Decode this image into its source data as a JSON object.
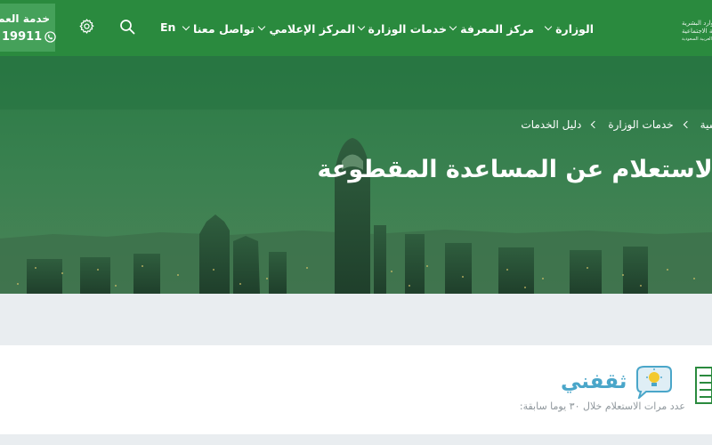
{
  "header": {
    "logo_lines": [
      "وزارة الموارد البشرية",
      "والتنمية الاجتماعية",
      "المملكة العربية السعودية"
    ],
    "nav": [
      {
        "label": "الوزارة"
      },
      {
        "label": "مركز المعرفة"
      },
      {
        "label": "خدمات الوزارة"
      },
      {
        "label": "المركز الإعلامي"
      },
      {
        "label": "تواصل معنا"
      }
    ],
    "lang_label": "En",
    "customer_service": {
      "title": "خدمة العملاء",
      "phone": "19911"
    }
  },
  "hero": {
    "breadcrumb": [
      "الرئيسية",
      "خدمات الوزارة",
      "دليل الخدمات"
    ],
    "title": "الاستعلام عن المساعدة المقطوعة"
  },
  "stats": {
    "watermark_text": "ثقفني",
    "label": "عدد مرات الاستعلام خلال ٣٠ يوما سابقة:"
  },
  "colors": {
    "brand_green": "#2a8a3e",
    "service_green": "#45a15a",
    "watermark_blue": "#4aa6c9"
  }
}
